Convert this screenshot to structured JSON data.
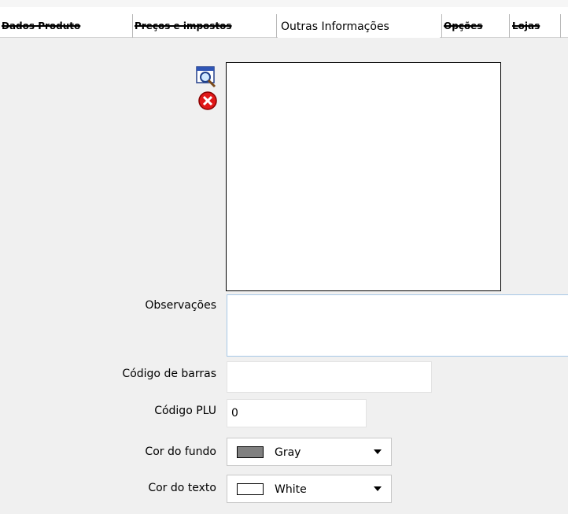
{
  "tabs": [
    {
      "label": "Dados Produto",
      "active": false
    },
    {
      "label": "Preços e impostos",
      "active": false
    },
    {
      "label": "Outras Informações",
      "active": true
    },
    {
      "label": "Opções",
      "active": false
    },
    {
      "label": "Lojas",
      "active": false
    }
  ],
  "image_controls": {
    "search_icon": "magnifier-icon",
    "remove_icon": "red-x-delete-icon"
  },
  "form": {
    "observacoes_label": "Observações",
    "observacoes_value": "",
    "codigo_barras_label": "Código de barras",
    "codigo_barras_value": "",
    "codigo_plu_label": "Código PLU",
    "codigo_plu_value": "0",
    "cor_fundo_label": "Cor do fundo",
    "cor_fundo_value": "Gray",
    "cor_fundo_color": "#808080",
    "cor_texto_label": "Cor do texto",
    "cor_texto_value": "White",
    "cor_texto_color": "#ffffff"
  }
}
